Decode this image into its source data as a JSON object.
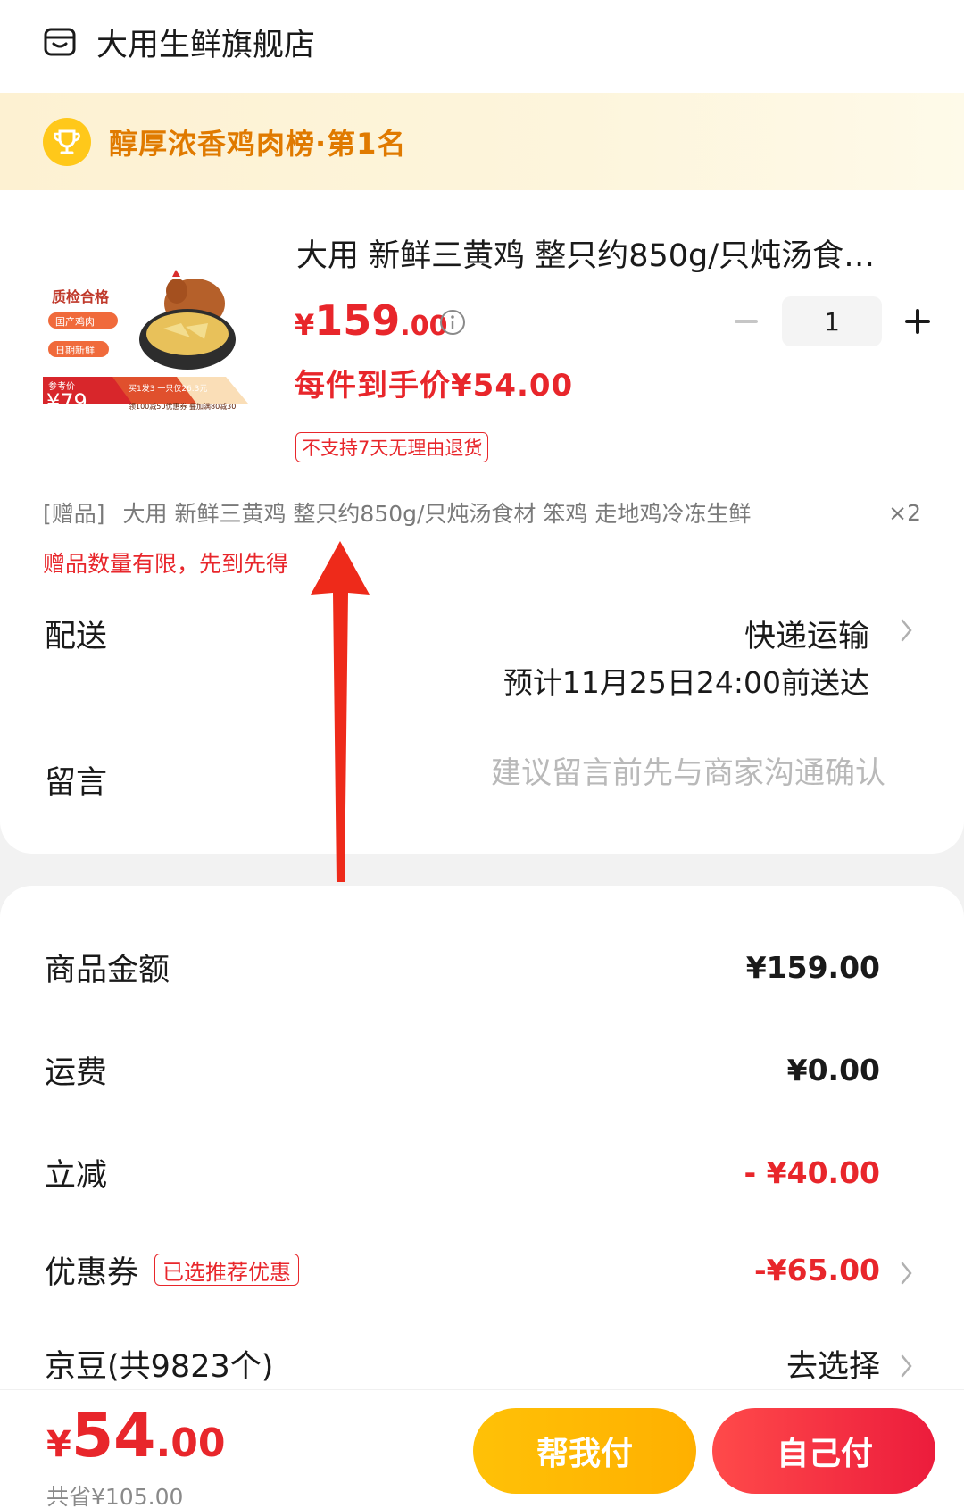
{
  "store": {
    "name": "大用生鲜旗舰店",
    "icon": "store-icon"
  },
  "rank_banner": {
    "text": "醇厚浓香鸡肉榜·第1名",
    "icon": "trophy-icon"
  },
  "product": {
    "title": "大用 新鲜三黄鸡 整只约850g/只炖汤食…",
    "image_badge_quality": "质检合格",
    "image_badge_origin": "国产鸡肉",
    "image_badge_fresh": "日期新鲜",
    "image_ref_label": "参考价",
    "image_ref_price": "¥79",
    "image_promo_1": "买1发3 一只仅26.3元",
    "image_promo_2": "领100减50优惠券 叠加满80减30",
    "price_symbol": "¥",
    "price_int": "159",
    "price_dec": ".00",
    "unit_price": "每件到手价¥54.00",
    "return_policy": "不支持7天无理由退货",
    "quantity": "1"
  },
  "gift": {
    "tag": "[赠品]",
    "name": "大用 新鲜三黄鸡 整只约850g/只炖汤食材 笨鸡 走地鸡冷冻生鲜",
    "qty": "×2",
    "note": "赠品数量有限，先到先得"
  },
  "delivery": {
    "label": "配送",
    "method": "快递运输",
    "eta": "预计11月25日24:00前送达"
  },
  "message": {
    "label": "留言",
    "placeholder": "建议留言前先与商家沟通确认"
  },
  "fees": {
    "goods_label": "商品金额",
    "goods_value": "¥159.00",
    "shipping_label": "运费",
    "shipping_value": "¥0.00",
    "discount_label": "立减",
    "discount_value": "- ¥40.00",
    "coupon_label": "优惠券",
    "coupon_badge": "已选推荐优惠",
    "coupon_value": "-¥65.00",
    "jingdou_label": "京豆(共9823个)",
    "jingdou_value": "去选择"
  },
  "footer": {
    "total_symbol": "¥",
    "total_int": "54",
    "total_dec": ".00",
    "saved": "共省¥105.00",
    "help_pay": "帮我付",
    "self_pay": "自己付"
  },
  "colors": {
    "accent_red": "#e8262b",
    "gold": "#ffc107",
    "rank_orange": "#e07a00"
  }
}
